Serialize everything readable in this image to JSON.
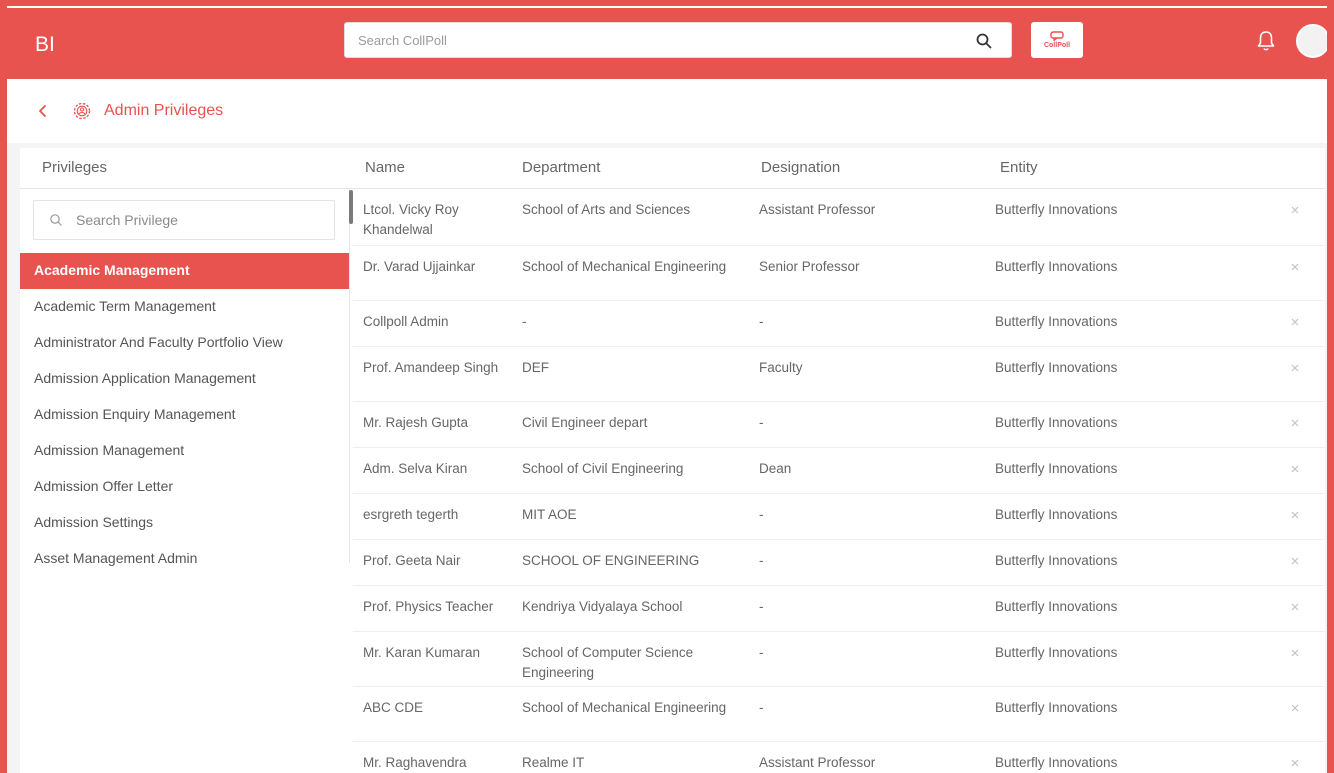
{
  "app": {
    "brand": "BI",
    "logo_text": "CollPoll"
  },
  "search": {
    "placeholder": "Search CollPoll"
  },
  "page": {
    "title": "Admin Privileges"
  },
  "table": {
    "headers": {
      "privileges": "Privileges",
      "name": "Name",
      "department": "Department",
      "designation": "Designation",
      "entity": "Entity"
    }
  },
  "privileges": {
    "search_placeholder": "Search Privilege",
    "items": [
      {
        "label": "Academic Management",
        "active": true
      },
      {
        "label": "Academic Term Management",
        "active": false
      },
      {
        "label": "Administrator And Faculty Portfolio View",
        "active": false
      },
      {
        "label": "Admission Application Management",
        "active": false
      },
      {
        "label": "Admission Enquiry Management",
        "active": false
      },
      {
        "label": "Admission Management",
        "active": false
      },
      {
        "label": "Admission Offer Letter",
        "active": false
      },
      {
        "label": "Admission Settings",
        "active": false
      },
      {
        "label": "Asset Management Admin",
        "active": false
      }
    ]
  },
  "rows": [
    {
      "name": "Ltcol. Vicky Roy Khandelwal",
      "department": "School of Arts and Sciences",
      "designation": "Assistant Professor",
      "entity": "Butterfly Innovations"
    },
    {
      "name": "Dr. Varad Ujjainkar",
      "department": "School of Mechanical Engineering",
      "designation": "Senior Professor",
      "entity": "Butterfly Innovations"
    },
    {
      "name": "Collpoll Admin",
      "department": "-",
      "designation": "-",
      "entity": "Butterfly Innovations"
    },
    {
      "name": "Prof. Amandeep Singh",
      "department": "DEF",
      "designation": "Faculty",
      "entity": "Butterfly Innovations"
    },
    {
      "name": "Mr. Rajesh Gupta",
      "department": "Civil Engineer depart",
      "designation": "-",
      "entity": "Butterfly Innovations"
    },
    {
      "name": "Adm. Selva Kiran",
      "department": "School of Civil Engineering",
      "designation": "Dean",
      "entity": "Butterfly Innovations"
    },
    {
      "name": "esrgreth tegerth",
      "department": "MIT AOE",
      "designation": "-",
      "entity": "Butterfly Innovations"
    },
    {
      "name": "Prof. Geeta Nair",
      "department": "SCHOOL OF ENGINEERING",
      "designation": "-",
      "entity": "Butterfly Innovations"
    },
    {
      "name": "Prof. Physics Teacher",
      "department": "Kendriya Vidyalaya School",
      "designation": "-",
      "entity": "Butterfly Innovations"
    },
    {
      "name": "Mr. Karan Kumaran",
      "department": "School of Computer Science Engineering",
      "designation": "-",
      "entity": "Butterfly Innovations"
    },
    {
      "name": "ABC CDE",
      "department": "School of Mechanical Engineering",
      "designation": "-",
      "entity": "Butterfly Innovations"
    },
    {
      "name": "Mr. Raghavendra",
      "department": "Realme IT",
      "designation": "Assistant Professor",
      "entity": "Butterfly Innovations"
    }
  ],
  "colors": {
    "accent": "#e8524f"
  }
}
